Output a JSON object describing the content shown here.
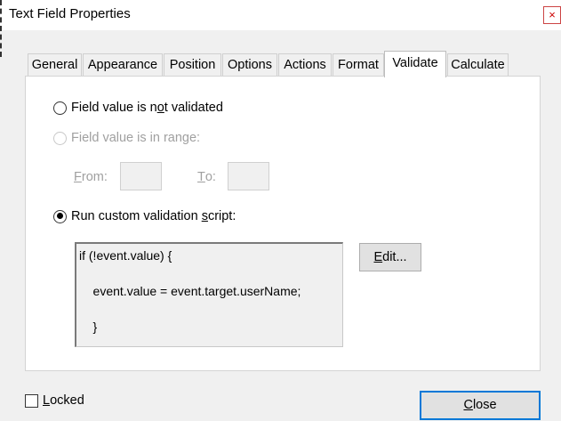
{
  "window": {
    "title": "Text Field Properties",
    "close_glyph": "×"
  },
  "tabs": [
    {
      "label": "General",
      "active": false
    },
    {
      "label": "Appearance",
      "active": false
    },
    {
      "label": "Position",
      "active": false
    },
    {
      "label": "Options",
      "active": false
    },
    {
      "label": "Actions",
      "active": false
    },
    {
      "label": "Format",
      "active": false
    },
    {
      "label": "Validate",
      "active": true
    },
    {
      "label": "Calculate",
      "active": false
    }
  ],
  "validate": {
    "not_validated": {
      "pre": "Field value is n",
      "mnemonic": "o",
      "post": "t validated",
      "selected": false
    },
    "in_range": {
      "label": "Field value is in range:",
      "selected": false,
      "enabled": false
    },
    "from": {
      "mnemonic": "F",
      "rest": "rom:",
      "value": ""
    },
    "to": {
      "mnemonic": "T",
      "rest": "o:",
      "value": ""
    },
    "custom": {
      "pre": "Run custom validation ",
      "mnemonic": "s",
      "post": "cript:",
      "selected": true
    },
    "script_lines": [
      "if (!event.value) {",
      "",
      "    event.value = event.target.userName;",
      "",
      "    }"
    ],
    "edit_button": {
      "mnemonic": "E",
      "rest": "dit..."
    }
  },
  "footer": {
    "locked": {
      "mnemonic": "L",
      "rest": "ocked",
      "checked": false
    },
    "close_button": {
      "mnemonic": "C",
      "rest": "lose"
    }
  },
  "colors": {
    "accent": "#0078d7",
    "panel_bg": "#ffffff",
    "dialog_bg": "#f0f0f0",
    "disabled_text": "#a0a0a0"
  }
}
